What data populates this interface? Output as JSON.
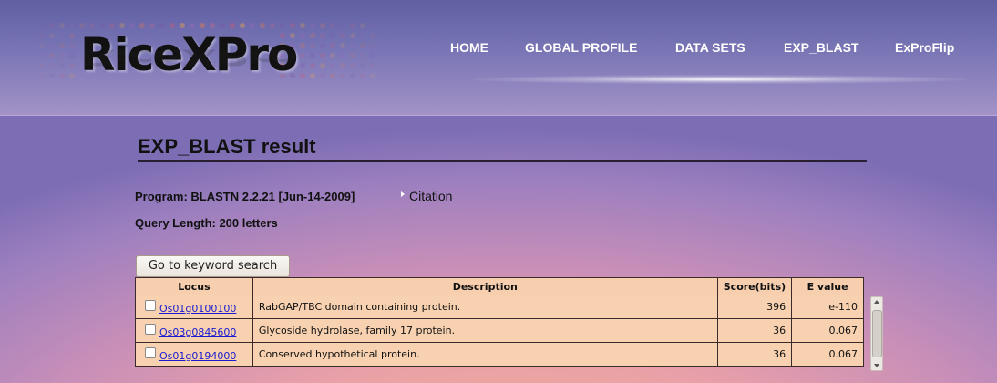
{
  "logo": {
    "text": "RiceXPro"
  },
  "nav": {
    "items": [
      {
        "label": "HOME"
      },
      {
        "label": "GLOBAL PROFILE"
      },
      {
        "label": "DATA SETS"
      },
      {
        "label": "EXP_BLAST"
      },
      {
        "label": "ExProFlip"
      }
    ]
  },
  "page": {
    "title": "EXP_BLAST result",
    "program_label": "Program: BLASTN 2.2.21 [Jun-14-2009]",
    "citation_label": "Citation",
    "query_length_label": "Query Length: 200 letters",
    "keyword_button": "Go to keyword search"
  },
  "results": {
    "headers": {
      "locus": "Locus",
      "description": "Description",
      "score": "Score(bits)",
      "evalue": "E value"
    },
    "rows": [
      {
        "locus": "Os01g0100100",
        "description": "RabGAP/TBC domain containing protein.",
        "score": "396",
        "evalue": "e-110",
        "checked": false
      },
      {
        "locus": "Os03g0845600",
        "description": "Glycoside hydrolase, family 17 protein.",
        "score": "36",
        "evalue": "0.067",
        "checked": false
      },
      {
        "locus": "Os01g0194000",
        "description": "Conserved hypothetical protein.",
        "score": "36",
        "evalue": "0.067",
        "checked": false
      }
    ]
  },
  "colors": {
    "link": "#1a1ad0",
    "table_bg": "#f8d2b0",
    "header_band": "#6a66ac"
  }
}
